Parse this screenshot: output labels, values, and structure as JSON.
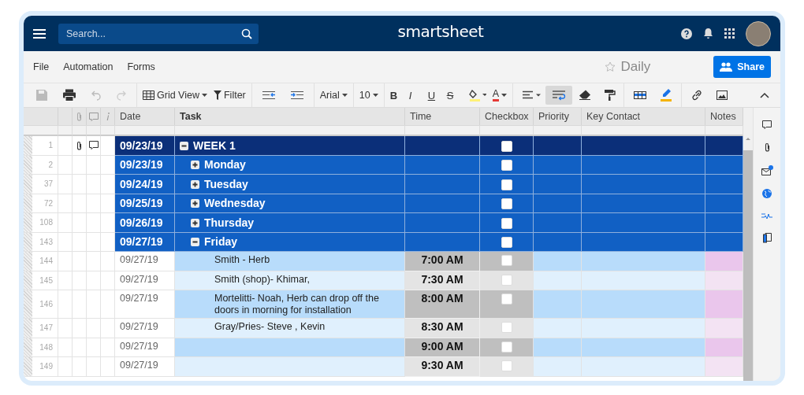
{
  "header": {
    "search": {
      "placeholder": "Search..."
    },
    "logo": "smartsheet"
  },
  "menu": [
    "File",
    "Automation",
    "Forms"
  ],
  "sheet": {
    "title": "Daily",
    "favorite": false
  },
  "share_button": "Share",
  "toolbar": {
    "view": "Grid View",
    "filter": "Filter",
    "font": "Arial",
    "size": "10",
    "bold": "B",
    "italic": "I",
    "underline": "U",
    "strike": "S",
    "font_color": "A",
    "wrap_on": true
  },
  "columns": [
    {
      "label": "Date"
    },
    {
      "label": "Task"
    },
    {
      "label": "Time"
    },
    {
      "label": "Checkbox"
    },
    {
      "label": "Priority"
    },
    {
      "label": "Key Contact"
    },
    {
      "label": "Notes"
    }
  ],
  "rows": [
    {
      "kind": "week",
      "row": "1",
      "date": "09/23/19",
      "task": "WEEK 1",
      "checked": false,
      "expanded": true,
      "attachment": true,
      "comment": true,
      "children": [
        {
          "kind": "day",
          "row": "2",
          "date": "09/23/19",
          "task": "Monday",
          "checked": false,
          "expanded": false
        },
        {
          "kind": "day",
          "row": "37",
          "date": "09/24/19",
          "task": "Tuesday",
          "checked": false,
          "expanded": false
        },
        {
          "kind": "day",
          "row": "72",
          "date": "09/25/19",
          "task": "Wednesday",
          "checked": false,
          "expanded": false
        },
        {
          "kind": "day",
          "row": "108",
          "date": "09/26/19",
          "task": "Thursday",
          "checked": false,
          "expanded": false
        },
        {
          "kind": "day",
          "row": "143",
          "date": "09/27/19",
          "task": "Friday",
          "checked": false,
          "expanded": true,
          "children": [
            {
              "row": "144",
              "date": "09/27/19",
              "task": "Smith - Herb",
              "time": "7:00 AM",
              "checked": false
            },
            {
              "row": "145",
              "date": "09/27/19",
              "task": "Smith (shop)- Khimar,",
              "time": "7:30 AM",
              "checked": false
            },
            {
              "row": "146",
              "date": "09/27/19",
              "task": "Mortelitti- Noah, Herb can drop off the doors in morning for installation",
              "time": "8:00 AM",
              "checked": false
            },
            {
              "row": "147",
              "date": "09/27/19",
              "task": "Gray/Pries- Steve , Kevin",
              "time": "8:30 AM",
              "checked": false
            },
            {
              "row": "148",
              "date": "09/27/19",
              "time": "9:00 AM",
              "checked": false
            },
            {
              "row": "149",
              "date": "09/27/19",
              "time": "9:30 AM",
              "checked": false
            }
          ]
        }
      ]
    }
  ]
}
